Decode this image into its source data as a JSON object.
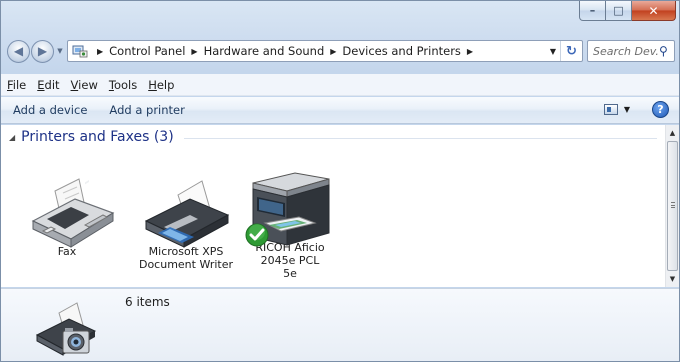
{
  "window": {
    "caption_buttons": {
      "minimize": "–",
      "maximize": "□",
      "close": "✕"
    }
  },
  "nav": {
    "back_icon": "back-arrow-icon",
    "forward_icon": "forward-arrow-icon",
    "breadcrumbs": [
      "Control Panel",
      "Hardware and Sound",
      "Devices and Printers"
    ],
    "search_placeholder": "Search Dev..."
  },
  "menu": [
    "File",
    "Edit",
    "View",
    "Tools",
    "Help"
  ],
  "commands": {
    "add_device": "Add a device",
    "add_printer": "Add a printer",
    "help_glyph": "?"
  },
  "group": {
    "title": "Printers and Faxes (3)",
    "devices": [
      {
        "name": "Fax",
        "icon": "fax-icon",
        "default": false
      },
      {
        "name": "Microsoft XPS Document Writer",
        "icon": "printer-icon",
        "default": false
      },
      {
        "name": "RICOH Aficio 2045e PCL 5e",
        "icon": "multifunction-printer-icon",
        "default": true
      }
    ]
  },
  "details": {
    "count": "6 items",
    "icon": "printer-camera-icon"
  },
  "colors": {
    "accent": "#1e3287",
    "titlebar": "#cddcef",
    "close": "#c1401f",
    "check": "#2e9a34"
  }
}
